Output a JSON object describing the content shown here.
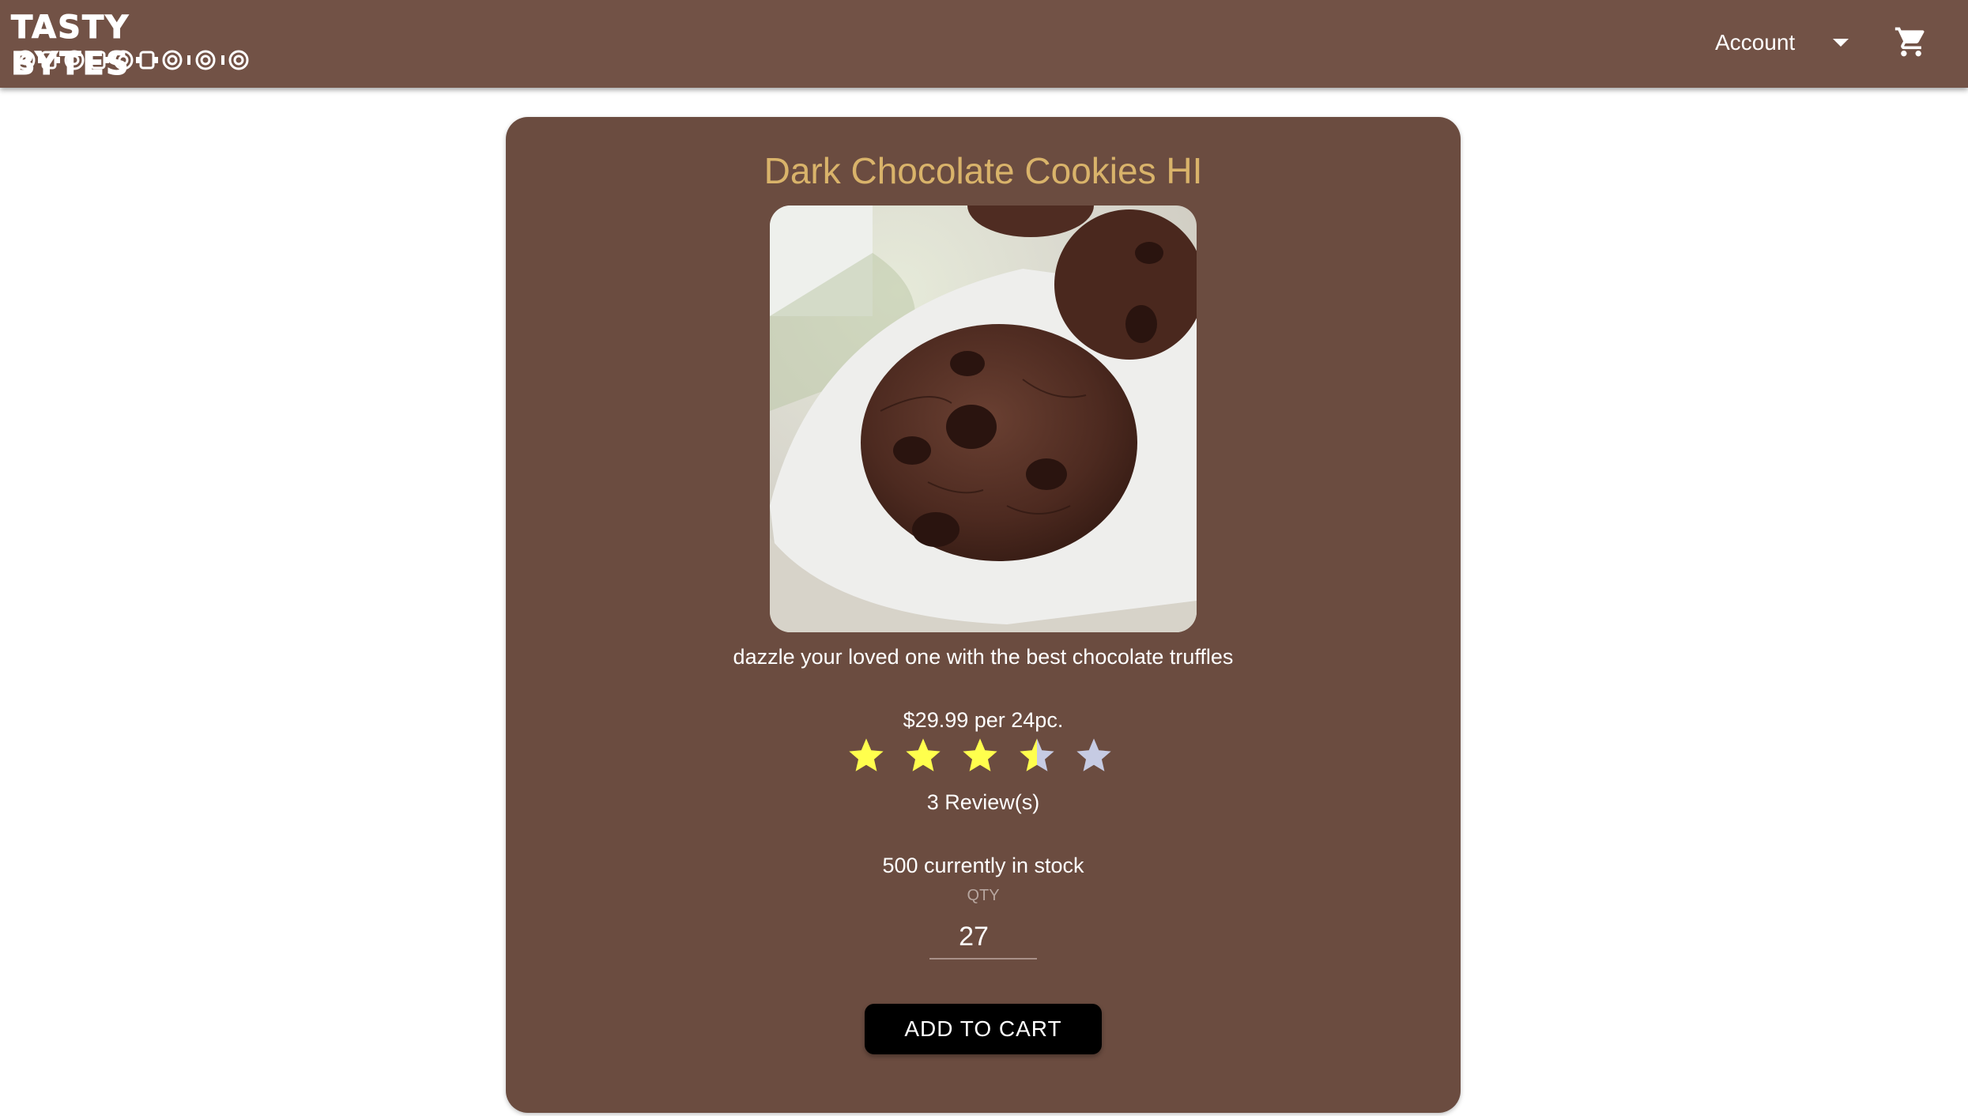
{
  "header": {
    "logo_text": "TASTY BYTES",
    "account_label": "Account",
    "account_caret_icon": "caret-down-icon",
    "cart_icon": "shopping-cart-icon",
    "background_color": "#725246"
  },
  "product": {
    "title": "Dark Chocolate Cookies HI",
    "image_alt": "dark chocolate cookie on a white plate",
    "description": "dazzle your loved one with the best chocolate truffles",
    "price": "$29.99 per 24pc.",
    "rating": 3.5,
    "rating_max": 5,
    "reviews": "3 Review(s)",
    "stock": "500 currently in stock",
    "qty_label": "QTY",
    "qty_value": "27",
    "add_to_cart_label": "ADD TO CART",
    "card_color": "#6b4c40",
    "title_color": "#d9b36a",
    "star_filled_color": "#ffff4d",
    "star_empty_color": "#c6cbe3"
  }
}
